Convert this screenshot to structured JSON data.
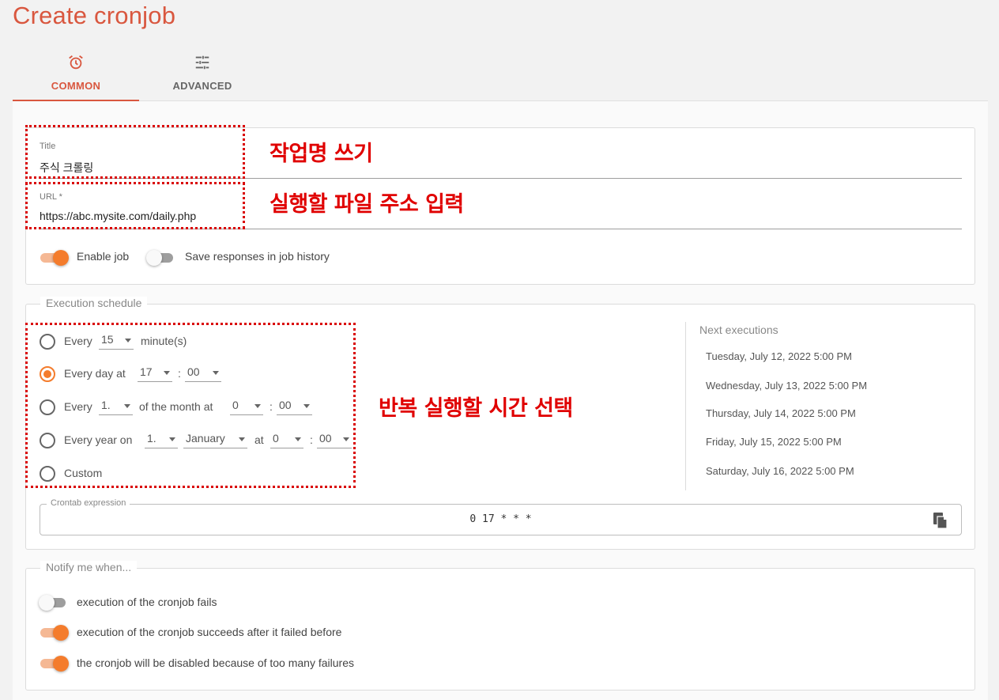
{
  "page_title": "Create cronjob",
  "tabs": [
    {
      "label": "COMMON",
      "icon": "alarm-clock-icon",
      "active": true
    },
    {
      "label": "ADVANCED",
      "icon": "tune-sliders-icon",
      "active": false
    }
  ],
  "colors": {
    "accent": "#d9573f",
    "toggle_on": "#f47c2c",
    "annotation": "#e00000"
  },
  "form": {
    "title_label": "Title",
    "title_value": "주식 크롤링",
    "url_label": "URL *",
    "url_value": "https://abc.mysite.com/daily.php",
    "enable_job_label": "Enable job",
    "enable_job_on": true,
    "save_responses_label": "Save responses in job history",
    "save_responses_on": false
  },
  "schedule": {
    "legend": "Execution schedule",
    "selected": "every_day",
    "row1": {
      "every": "Every",
      "minutes": "15",
      "unit": "minute(s)"
    },
    "row2": {
      "label": "Every day at",
      "hour": "17",
      "sep": ":",
      "minute": "00"
    },
    "row3": {
      "every": "Every",
      "day": "1.",
      "mid": "of the month at",
      "hour": "0",
      "sep": ":",
      "minute": "00"
    },
    "row4": {
      "label": "Every year on",
      "day": "1.",
      "month": "January",
      "at": "at",
      "hour": "0",
      "sep": ":",
      "minute": "00"
    },
    "row5": {
      "label": "Custom"
    },
    "next_title": "Next executions",
    "next_executions": [
      "Tuesday, July 12, 2022 5:00 PM",
      "Wednesday, July 13, 2022 5:00 PM",
      "Thursday, July 14, 2022 5:00 PM",
      "Friday, July 15, 2022 5:00 PM",
      "Saturday, July 16, 2022 5:00 PM"
    ],
    "crontab_label": "Crontab expression",
    "crontab_value": "0 17 * * *"
  },
  "notify": {
    "legend": "Notify me when...",
    "items": [
      {
        "label": "execution of the cronjob fails",
        "on": false
      },
      {
        "label": "execution of the cronjob succeeds after it failed before",
        "on": true
      },
      {
        "label": "the cronjob will be disabled because of too many failures",
        "on": true
      }
    ]
  },
  "annotations": {
    "title_note": "작업명 쓰기",
    "url_note": "실행할 파일 주소 입력",
    "schedule_note": "반복 실행할 시간 선택"
  }
}
